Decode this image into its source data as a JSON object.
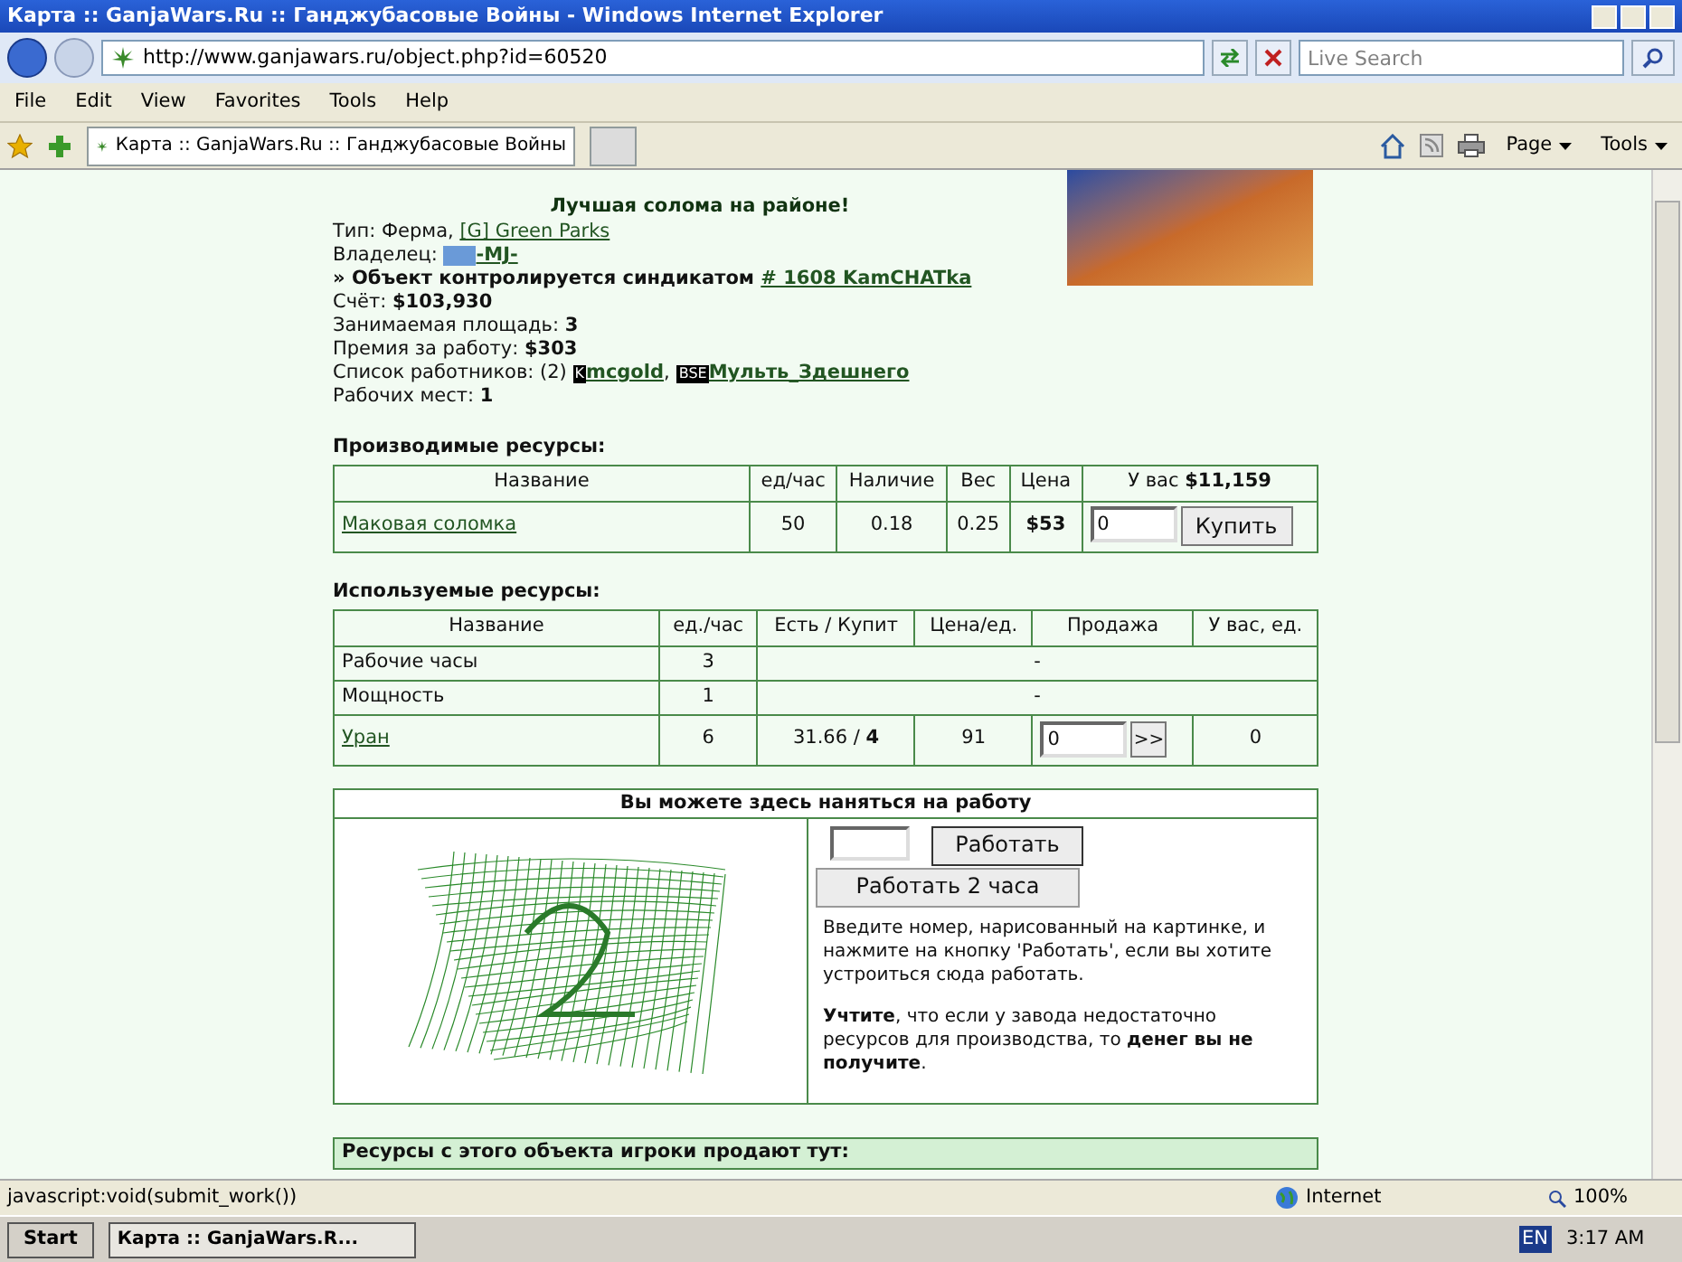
{
  "window": {
    "title": "Карта :: GanjaWars.Ru :: Ганджубасовые Войны - Windows Internet Explorer"
  },
  "address_bar": {
    "url": "http://www.ganjawars.ru/object.php?id=60520"
  },
  "search": {
    "placeholder": "Live Search"
  },
  "menu": [
    "File",
    "Edit",
    "View",
    "Favorites",
    "Tools",
    "Help"
  ],
  "tabs": [
    {
      "label": "Карта :: GanjaWars.Ru :: Ганджубасовые Войны",
      "selected": true
    }
  ],
  "command_bar": [
    "Page",
    "Tools"
  ],
  "object": {
    "heading": "Лучшая солома на районе!",
    "type_label": "Тип: Ферма, ",
    "type_link": "[G] Green Parks",
    "owner_label": "Владелец: ",
    "owner_link": "-MJ-",
    "syndicate_label": "» Объект контролируется синдикатом ",
    "syndicate_link": "# 1608 KamCHATka",
    "facts": [
      {
        "label": "Счёт: ",
        "value": "$103,930"
      },
      {
        "label": "Занимаемая площадь: ",
        "value": "3"
      },
      {
        "label": "Премия за работу: ",
        "value": "$303"
      }
    ],
    "workers_label": "Список работников: (2) ",
    "workers_separator": ",",
    "workers": [
      {
        "badge": "K",
        "name": "mcgold"
      },
      {
        "badge": "BSE",
        "name": "Мульть_Здешнего"
      }
    ],
    "places_label": "Рабочих мест: ",
    "places_value": "1"
  },
  "produced": {
    "title": "Производимые ресурсы:",
    "columns": [
      "Название",
      "ед/час",
      "Наличие",
      "Вес",
      "Цена",
      "У вас **$11,159**"
    ],
    "rows": [
      {
        "name": "Маковая соломка",
        "per_hour": "50",
        "stock": "0.18",
        "weight": "0.25",
        "price": "$53",
        "quantity": "0",
        "button": "Купить"
      }
    ]
  },
  "used": {
    "title": "Используемые ресурсы:",
    "columns": [
      "Название",
      "ед./час",
      "Есть / Купит",
      "Цена/ед.",
      "Продажа",
      "У вас, ед."
    ],
    "rows": [
      {
        "kind": "plain",
        "name": "Рабочие часы",
        "per_hour": "3",
        "dash": "-"
      },
      {
        "kind": "plain",
        "name": "Мощность",
        "per_hour": "1",
        "dash": "-"
      },
      {
        "kind": "trade",
        "name": "Уран",
        "per_hour": "6",
        "have_buy": "31.66 / **4**",
        "price": "91",
        "quantity": "0",
        "button": ">>",
        "yours": "0"
      }
    ]
  },
  "work": {
    "title": "Вы можете здесь наняться на работу",
    "work_button": "Работать",
    "work2_button": "Работать 2 часа",
    "instructions": "Введите номер, нарисованный на картинке, и нажмите на кнопку 'Работать', если вы хотите устроиться сюда работать.",
    "warning": "**Учтите**, что если у завода недостаточно ресурсов для производства, то **денег вы не получите**."
  },
  "sellers": {
    "title": "Ресурсы с этого объекта игроки продают тут:"
  },
  "status_bar": {
    "text": "javascript:void(submit_work())",
    "zone": "Internet",
    "zoom": "100%"
  },
  "taskbar": {
    "start": "Start",
    "task": "Карта :: GanjaWars.R...",
    "lang": "EN",
    "time": "3:17 AM"
  }
}
